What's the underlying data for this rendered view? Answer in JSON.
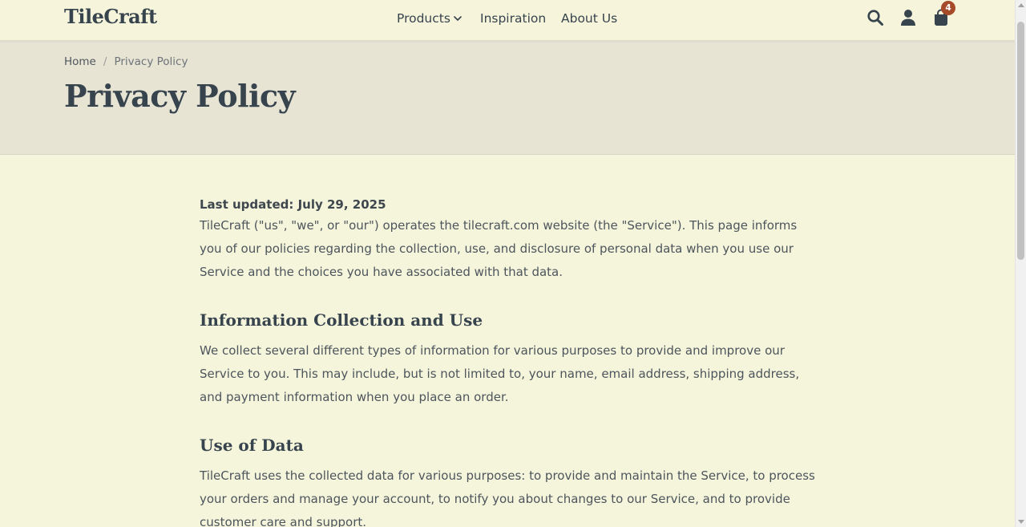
{
  "header": {
    "brand": "TileCraft",
    "nav": [
      {
        "label": "Products",
        "icon": "chevron-down-icon"
      },
      {
        "label": "Inspiration"
      },
      {
        "label": "About Us"
      }
    ],
    "icons": {
      "search": "search-icon",
      "account": "user-icon",
      "cart": "shopping-bag-icon"
    },
    "cart_count": "4"
  },
  "breadcrumb": {
    "home": "Home",
    "separator": "/",
    "current": "Privacy Policy"
  },
  "page": {
    "title": "Privacy Policy"
  },
  "content": {
    "last_updated": "Last updated: July 29, 2025",
    "intro": "TileCraft (\"us\", \"we\", or \"our\") operates the tilecraft.com website (the \"Service\"). This page informs you of our policies regarding the collection, use, and disclosure of personal data when you use our Service and the choices you have associated with that data.",
    "sections": [
      {
        "title": "Information Collection and Use",
        "body": "We collect several different types of information for various purposes to provide and improve our Service to you. This may include, but is not limited to, your name, email address, shipping address, and payment information when you place an order."
      },
      {
        "title": "Use of Data",
        "body": "TileCraft uses the collected data for various purposes: to provide and maintain the Service, to process your orders and manage your account, to notify you about changes to our Service, and to provide customer care and support."
      }
    ]
  },
  "colors": {
    "background": "#f5f5dc",
    "hero_background": "#e7e4d4",
    "heading_text": "#37434d",
    "body_text": "#4d555c",
    "badge": "#a64b2a"
  }
}
